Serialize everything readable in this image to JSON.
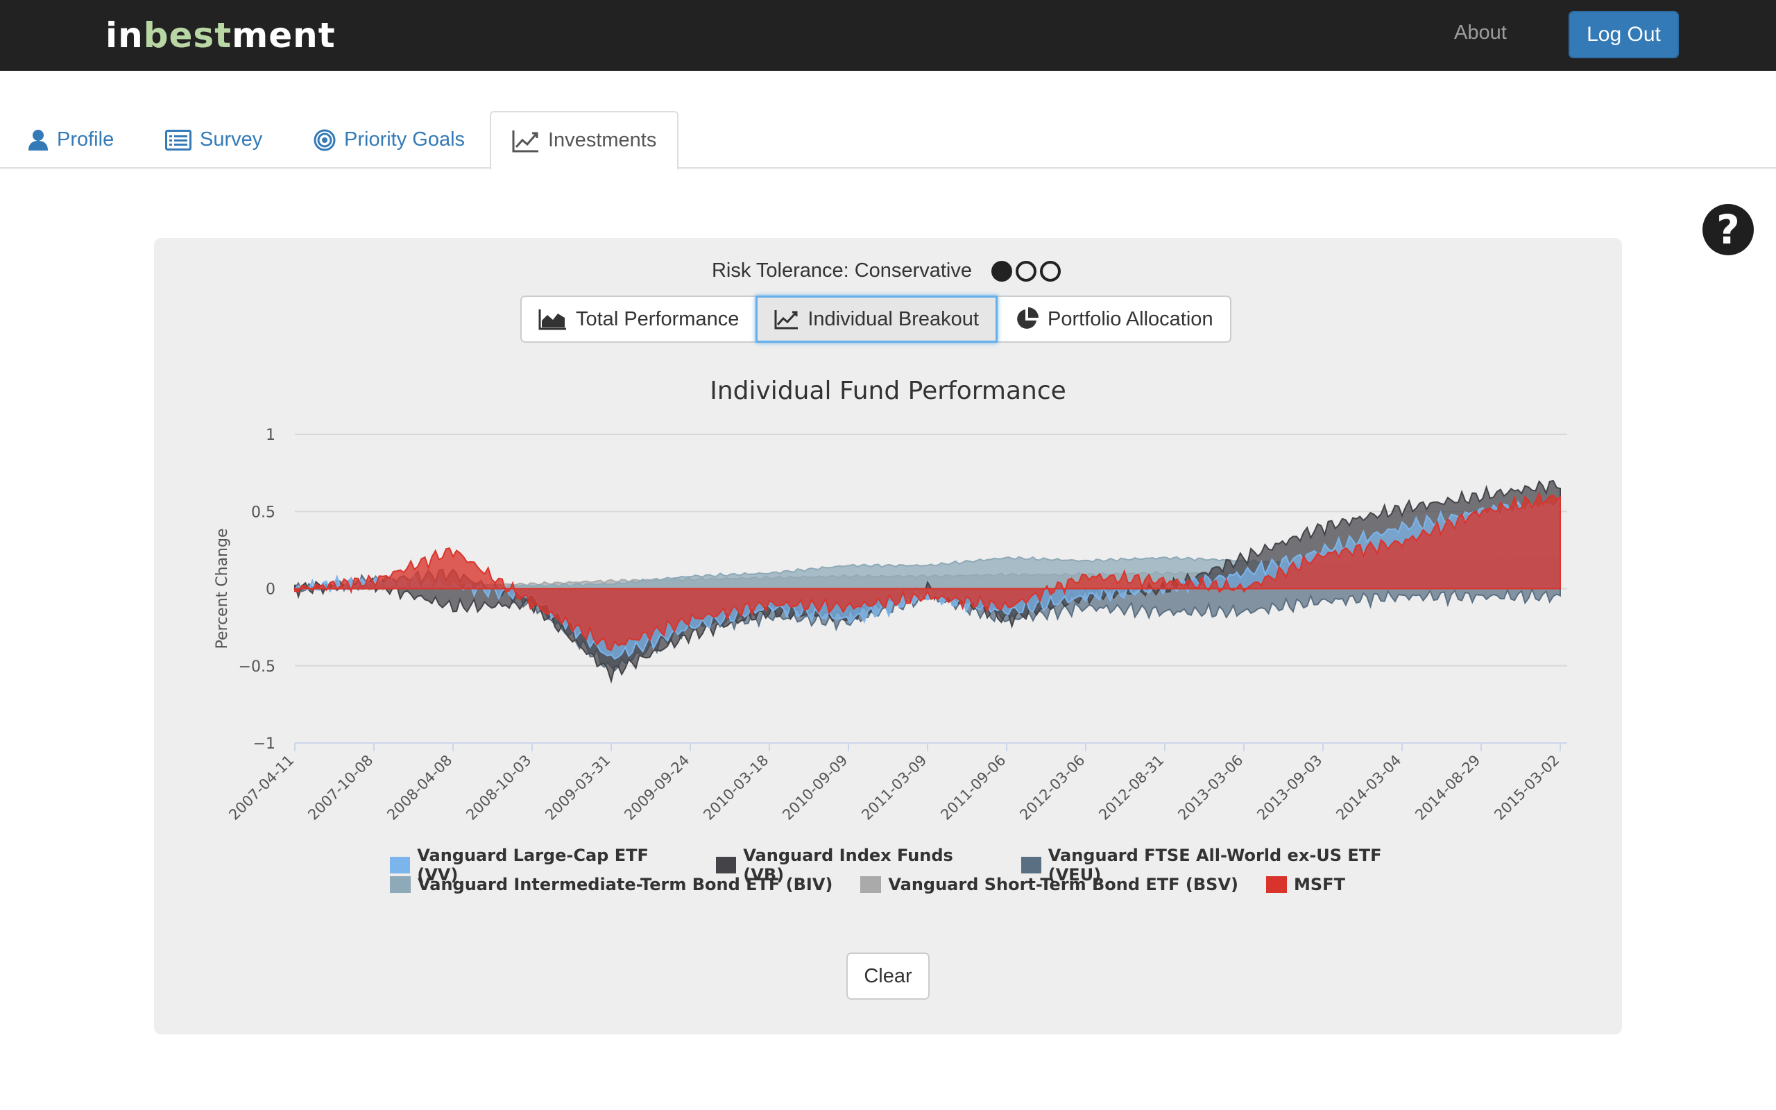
{
  "navbar": {
    "brand_pre": "in",
    "brand_mid": "best",
    "brand_post": "ment",
    "about_label": "About",
    "logout_label": "Log Out"
  },
  "tabs": [
    {
      "label": "Profile",
      "icon": "user-icon"
    },
    {
      "label": "Survey",
      "icon": "list-icon"
    },
    {
      "label": "Priority Goals",
      "icon": "target-icon"
    },
    {
      "label": "Investments",
      "icon": "line-chart-icon",
      "active": true
    }
  ],
  "help_icon": "?",
  "panel": {
    "risk_label": "Risk Tolerance: Conservative",
    "risk_level": 1,
    "risk_max": 3,
    "view_buttons": [
      {
        "label": "Total Performance",
        "icon": "area-chart-icon"
      },
      {
        "label": "Individual Breakout",
        "icon": "line-chart-icon",
        "active": true
      },
      {
        "label": "Portfolio Allocation",
        "icon": "pie-chart-icon"
      }
    ],
    "clear_label": "Clear"
  },
  "chart_data": {
    "type": "area",
    "title": "Individual Fund Performance",
    "xlabel": "",
    "ylabel": "Percent Change",
    "ylim": [
      -1,
      1
    ],
    "yticks": [
      "1",
      "0.5",
      "0",
      "−0.5",
      "−1"
    ],
    "xticks": [
      "2007-04-11",
      "2007-10-08",
      "2008-04-08",
      "2008-10-03",
      "2009-03-31",
      "2009-09-24",
      "2010-03-18",
      "2010-09-09",
      "2011-03-09",
      "2011-09-06",
      "2012-03-06",
      "2012-08-31",
      "2013-03-06",
      "2013-09-03",
      "2014-03-04",
      "2014-08-29",
      "2015-03-02"
    ],
    "grid": true,
    "legend_position": "bottom",
    "series": [
      {
        "name": "Vanguard Large-Cap ETF (VV)",
        "color": "#7cb5ec",
        "values": [
          0.0,
          0.05,
          0.02,
          -0.05,
          -0.45,
          -0.25,
          -0.12,
          -0.2,
          -0.05,
          -0.15,
          -0.05,
          0.0,
          0.1,
          0.25,
          0.4,
          0.5,
          0.55
        ]
      },
      {
        "name": "Vanguard Index Funds (VB)",
        "color": "#434348",
        "values": [
          0.0,
          0.03,
          -0.12,
          -0.1,
          -0.55,
          -0.3,
          -0.15,
          -0.18,
          0.0,
          -0.2,
          -0.05,
          0.0,
          0.2,
          0.4,
          0.52,
          0.6,
          0.68
        ]
      },
      {
        "name": "Vanguard FTSE All-World ex-US ETF (VEU)",
        "color": "#5a6f82",
        "values": [
          0.0,
          0.05,
          0.1,
          -0.1,
          -0.52,
          -0.25,
          -0.18,
          -0.22,
          -0.05,
          -0.2,
          -0.12,
          -0.15,
          -0.15,
          -0.08,
          -0.05,
          -0.05,
          -0.05
        ]
      },
      {
        "name": "Vanguard Intermediate-Term Bond ETF (BIV)",
        "color": "#8ea9b8",
        "values": [
          0.0,
          0.0,
          0.02,
          0.02,
          0.03,
          0.08,
          0.1,
          0.15,
          0.15,
          0.2,
          0.18,
          0.2,
          0.18,
          0.15,
          0.18,
          0.18,
          0.2
        ]
      },
      {
        "name": "Vanguard Short-Term Bond ETF (BSV)",
        "color": "#aaaaaa",
        "values": [
          0.0,
          0.0,
          0.02,
          0.03,
          0.05,
          0.06,
          0.07,
          0.08,
          0.08,
          0.09,
          0.09,
          0.1,
          0.1,
          0.1,
          0.1,
          0.11,
          0.12
        ]
      },
      {
        "name": "MSFT",
        "color": "#d9342b",
        "values": [
          0.0,
          0.05,
          0.25,
          -0.1,
          -0.38,
          -0.2,
          -0.1,
          -0.12,
          -0.05,
          -0.12,
          0.08,
          0.05,
          0.0,
          0.22,
          0.3,
          0.5,
          0.6
        ]
      }
    ]
  }
}
